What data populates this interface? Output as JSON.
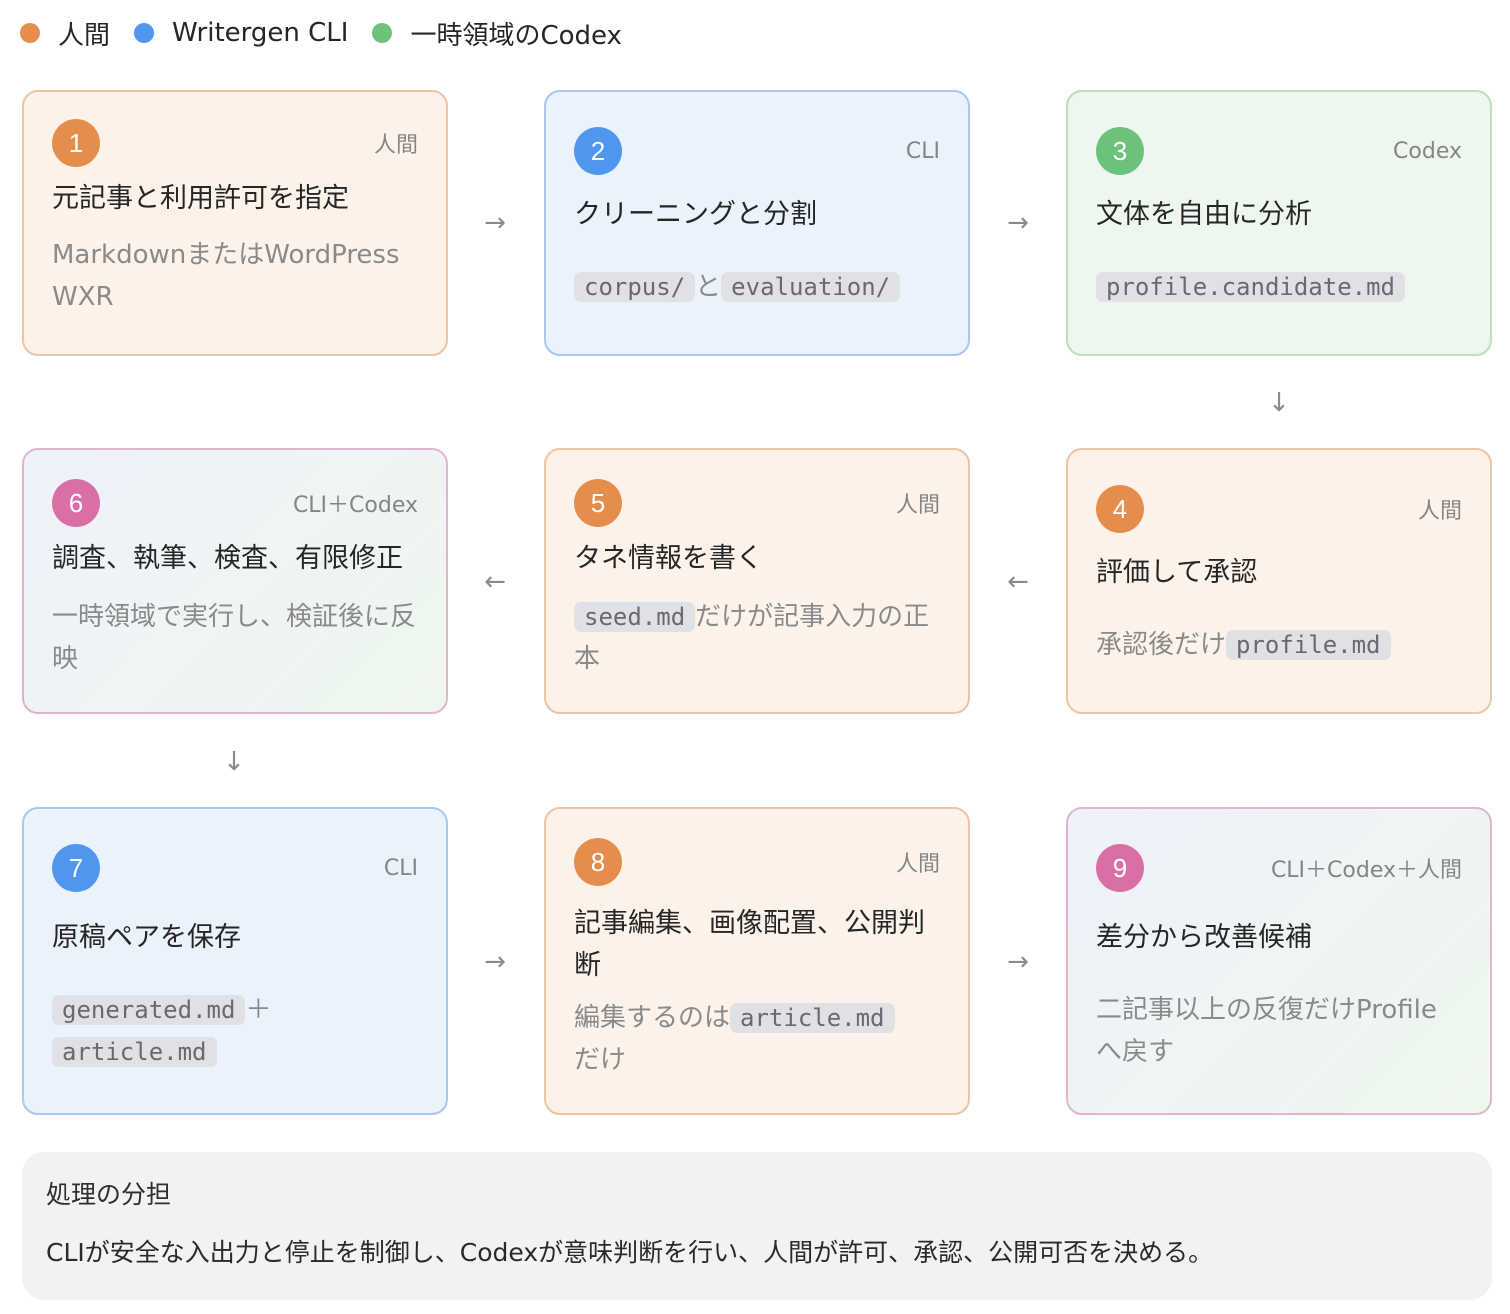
{
  "legend": [
    {
      "label": "人間",
      "color": "#e58d4d"
    },
    {
      "label": "Writergen CLI",
      "color": "#4f96ef"
    },
    {
      "label": "一時領域のCodex",
      "color": "#6cc27a"
    }
  ],
  "steps": [
    {
      "number": "1",
      "actor": "人間",
      "title": "元記事と利用許可を指定",
      "desc_text_1": "MarkdownまたはWordPress WXR"
    },
    {
      "number": "2",
      "actor": "CLI",
      "title": "クリーニングと分割",
      "code_1": "corpus/",
      "desc_text_1": "と",
      "code_2": "evaluation/"
    },
    {
      "number": "3",
      "actor": "Codex",
      "title": "文体を自由に分析",
      "code_1": "profile.candidate.md"
    },
    {
      "number": "4",
      "actor": "人間",
      "title": "評価して承認",
      "desc_text_1": "承認後だけ",
      "code_1": "profile.md"
    },
    {
      "number": "5",
      "actor": "人間",
      "title": "タネ情報を書く",
      "code_1": "seed.md",
      "desc_text_1": "だけが記事入力の正本"
    },
    {
      "number": "6",
      "actor": "CLI＋Codex",
      "title": "調査、執筆、検査、有限修正",
      "desc_text_1": "一時領域で実行し、検証後に反映"
    },
    {
      "number": "7",
      "actor": "CLI",
      "title": "原稿ペアを保存",
      "code_1": "generated.md",
      "desc_text_1": "＋",
      "code_2": "article.md"
    },
    {
      "number": "8",
      "actor": "人間",
      "title": "記事編集、画像配置、公開判断",
      "desc_text_1": "編集するのは",
      "code_1": "article.md",
      "desc_text_2": "だけ"
    },
    {
      "number": "9",
      "actor": "CLI＋Codex＋人間",
      "title": "差分から改善候補",
      "desc_text_1": "二記事以上の反復だけProfileへ戻す"
    }
  ],
  "arrows": {
    "right": "→",
    "left": "←",
    "down": "↓"
  },
  "note": {
    "title": "処理の分担",
    "body": "CLIが安全な入出力と停止を制御し、Codexが意味判断を行い、人間が許可、承認、公開可否を決める。"
  },
  "colors": {
    "human": "#e58d4d",
    "cli": "#4f96ef",
    "codex": "#6cc27a",
    "mixed": "#da6fa6"
  }
}
